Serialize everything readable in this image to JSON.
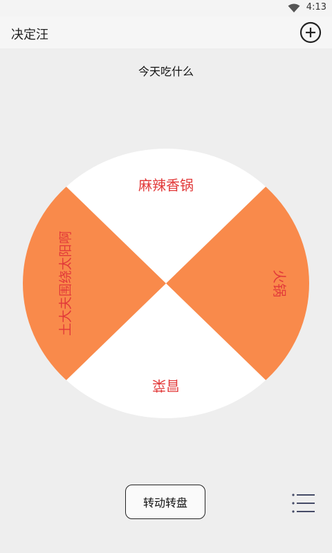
{
  "status_bar": {
    "time": "4:13"
  },
  "app_bar": {
    "title": "决定汪"
  },
  "page": {
    "subtitle": "今天吃什么"
  },
  "wheel": {
    "segments": [
      {
        "label": "麻辣香锅",
        "color": "#ffffff"
      },
      {
        "label": "火锅",
        "color": "#f98a4b"
      },
      {
        "label": "冒菜",
        "color": "#ffffff"
      },
      {
        "label": "土大夫围绕太阳啊",
        "color": "#f98a4b"
      }
    ],
    "label_color": "#e23a3a"
  },
  "actions": {
    "spin_label": "转动转盘"
  }
}
